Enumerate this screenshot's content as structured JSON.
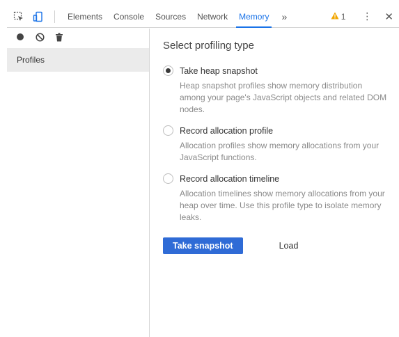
{
  "toolbar": {
    "tabs": [
      "Elements",
      "Console",
      "Sources",
      "Network",
      "Memory"
    ],
    "active_tab": "Memory",
    "more_tabs_label": "»",
    "warning_count": "1",
    "kebab_label": "⋮",
    "close_label": "✕"
  },
  "sidebar": {
    "profiles_label": "Profiles"
  },
  "main": {
    "title": "Select profiling type",
    "options": [
      {
        "label": "Take heap snapshot",
        "description": "Heap snapshot profiles show memory distribution among your page's JavaScript objects and related DOM nodes.",
        "checked": true
      },
      {
        "label": "Record allocation profile",
        "description": "Allocation profiles show memory allocations from your JavaScript functions.",
        "checked": false
      },
      {
        "label": "Record allocation timeline",
        "description": "Allocation timelines show memory allocations from your heap over time. Use this profile type to isolate memory leaks.",
        "checked": false
      }
    ],
    "primary_button_label": "Take snapshot",
    "load_button_label": "Load"
  },
  "colors": {
    "accent": "#1a73e8",
    "primary_button": "#2f6bd6",
    "warning": "#f2a600"
  },
  "icons": [
    "inspect-icon",
    "device-toggle-icon",
    "record-icon",
    "clear-icon",
    "trash-icon",
    "warning-icon"
  ]
}
